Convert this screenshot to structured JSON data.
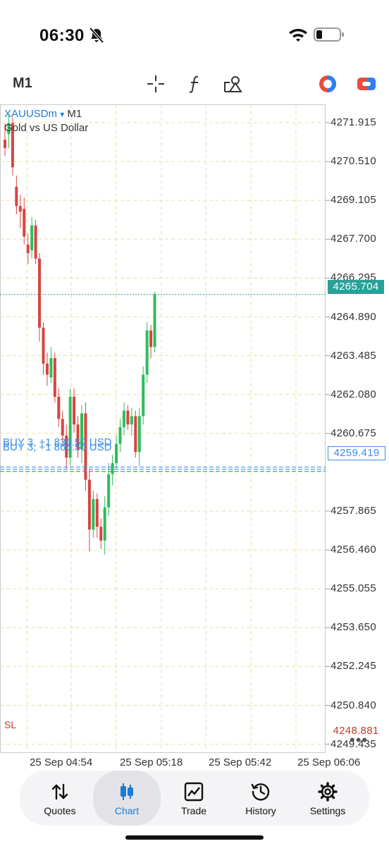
{
  "status": {
    "time": "06:30"
  },
  "toolbar": {
    "timeframe": "M1",
    "icons": [
      "crosshair-icon",
      "indicator-f-icon",
      "objects-icon",
      "account-color-icon",
      "trade-toggle-icon"
    ]
  },
  "chart": {
    "symbol": "XAUUSDm",
    "symbol_arrow": "▾",
    "timeframe": "M1",
    "description": "Gold vs US Dollar",
    "price_labels": [
      "4271.915",
      "4270.510",
      "4269.105",
      "4267.700",
      "4266.295",
      "4264.890",
      "4263.485",
      "4262.080",
      "4260.675",
      "4257.865",
      "4256.460",
      "4255.055",
      "4253.650",
      "4252.245",
      "4250.840",
      "4249.435"
    ],
    "current_price": "4265.704",
    "order_price": "4259.419",
    "sl_price": "4248.881",
    "order_label_1": "BUY 3, +1 836.50 USD",
    "order_label_2": "BUY 3, +1 866.50 USD",
    "sl_label": "SL",
    "time_labels": [
      "25 Sep 04:54",
      "25 Sep 05:18",
      "25 Sep 05:42",
      "25 Sep 06:06"
    ],
    "colors": {
      "bull": "#2ebd5b",
      "bear": "#d64541",
      "grid": "#e9dfa0",
      "bid": "#2aa198",
      "order": "#3a8ee6",
      "sl": "#c0392b"
    }
  },
  "chart_data": {
    "type": "candlestick",
    "symbol": "XAUUSDm",
    "timeframe": "M1",
    "ylim": [
      4248.0,
      4272.5
    ],
    "candles": [
      {
        "o": 4271.3,
        "h": 4271.9,
        "l": 4270.7,
        "c": 4271.0
      },
      {
        "o": 4271.5,
        "h": 4272.2,
        "l": 4271.0,
        "c": 4271.9
      },
      {
        "o": 4271.9,
        "h": 4272.1,
        "l": 4270.0,
        "c": 4270.3
      },
      {
        "o": 4269.6,
        "h": 4270.0,
        "l": 4268.6,
        "c": 4268.9
      },
      {
        "o": 4268.9,
        "h": 4269.3,
        "l": 4268.1,
        "c": 4268.7
      },
      {
        "o": 4268.8,
        "h": 4269.2,
        "l": 4267.5,
        "c": 4267.8
      },
      {
        "o": 4267.5,
        "h": 4267.9,
        "l": 4266.8,
        "c": 4267.2
      },
      {
        "o": 4267.3,
        "h": 4268.5,
        "l": 4267.0,
        "c": 4268.2
      },
      {
        "o": 4268.2,
        "h": 4268.4,
        "l": 4266.8,
        "c": 4267.0
      },
      {
        "o": 4267.0,
        "h": 4267.2,
        "l": 4264.0,
        "c": 4264.5
      },
      {
        "o": 4264.5,
        "h": 4264.7,
        "l": 4262.8,
        "c": 4263.2
      },
      {
        "o": 4263.2,
        "h": 4263.6,
        "l": 4262.4,
        "c": 4262.8
      },
      {
        "o": 4262.7,
        "h": 4263.8,
        "l": 4262.5,
        "c": 4263.4
      },
      {
        "o": 4263.4,
        "h": 4263.6,
        "l": 4261.8,
        "c": 4262.0
      },
      {
        "o": 4262.0,
        "h": 4262.3,
        "l": 4260.9,
        "c": 4261.2
      },
      {
        "o": 4261.2,
        "h": 4261.5,
        "l": 4260.3,
        "c": 4260.6
      },
      {
        "o": 4260.6,
        "h": 4261.0,
        "l": 4259.4,
        "c": 4259.8
      },
      {
        "o": 4259.8,
        "h": 4262.3,
        "l": 4259.5,
        "c": 4262.0
      },
      {
        "o": 4262.0,
        "h": 4262.3,
        "l": 4260.7,
        "c": 4261.0
      },
      {
        "o": 4261.0,
        "h": 4261.3,
        "l": 4259.8,
        "c": 4260.1
      },
      {
        "o": 4260.1,
        "h": 4261.7,
        "l": 4259.6,
        "c": 4261.4
      },
      {
        "o": 4261.4,
        "h": 4261.8,
        "l": 4258.6,
        "c": 4259.0
      },
      {
        "o": 4259.0,
        "h": 4259.4,
        "l": 4256.4,
        "c": 4257.2
      },
      {
        "o": 4257.2,
        "h": 4258.6,
        "l": 4256.9,
        "c": 4258.3
      },
      {
        "o": 4258.3,
        "h": 4258.5,
        "l": 4256.9,
        "c": 4257.3
      },
      {
        "o": 4257.3,
        "h": 4257.6,
        "l": 4256.5,
        "c": 4256.8
      },
      {
        "o": 4256.8,
        "h": 4258.4,
        "l": 4256.3,
        "c": 4258.0
      },
      {
        "o": 4258.0,
        "h": 4259.6,
        "l": 4257.7,
        "c": 4259.2
      },
      {
        "o": 4259.2,
        "h": 4259.9,
        "l": 4258.8,
        "c": 4259.6
      },
      {
        "o": 4259.6,
        "h": 4260.6,
        "l": 4259.4,
        "c": 4260.3
      },
      {
        "o": 4260.3,
        "h": 4261.2,
        "l": 4260.0,
        "c": 4260.9
      },
      {
        "o": 4260.9,
        "h": 4261.8,
        "l": 4260.6,
        "c": 4261.5
      },
      {
        "o": 4261.5,
        "h": 4261.7,
        "l": 4260.8,
        "c": 4261.0
      },
      {
        "o": 4261.0,
        "h": 4261.6,
        "l": 4260.6,
        "c": 4261.3
      },
      {
        "o": 4261.3,
        "h": 4261.5,
        "l": 4259.8,
        "c": 4260.0
      },
      {
        "o": 4260.0,
        "h": 4261.6,
        "l": 4259.5,
        "c": 4261.3
      },
      {
        "o": 4261.3,
        "h": 4263.1,
        "l": 4261.0,
        "c": 4262.8
      },
      {
        "o": 4262.8,
        "h": 4264.7,
        "l": 4262.5,
        "c": 4264.4
      },
      {
        "o": 4264.4,
        "h": 4264.6,
        "l": 4263.4,
        "c": 4263.8
      },
      {
        "o": 4263.8,
        "h": 4265.8,
        "l": 4263.6,
        "c": 4265.7
      }
    ]
  },
  "tabs": [
    {
      "label": "Quotes",
      "icon": "quotes-arrows-icon",
      "active": false
    },
    {
      "label": "Chart",
      "icon": "candles-icon",
      "active": true
    },
    {
      "label": "Trade",
      "icon": "trade-chart-icon",
      "active": false
    },
    {
      "label": "History",
      "icon": "history-clock-icon",
      "active": false
    },
    {
      "label": "Settings",
      "icon": "gear-icon",
      "active": false
    }
  ]
}
